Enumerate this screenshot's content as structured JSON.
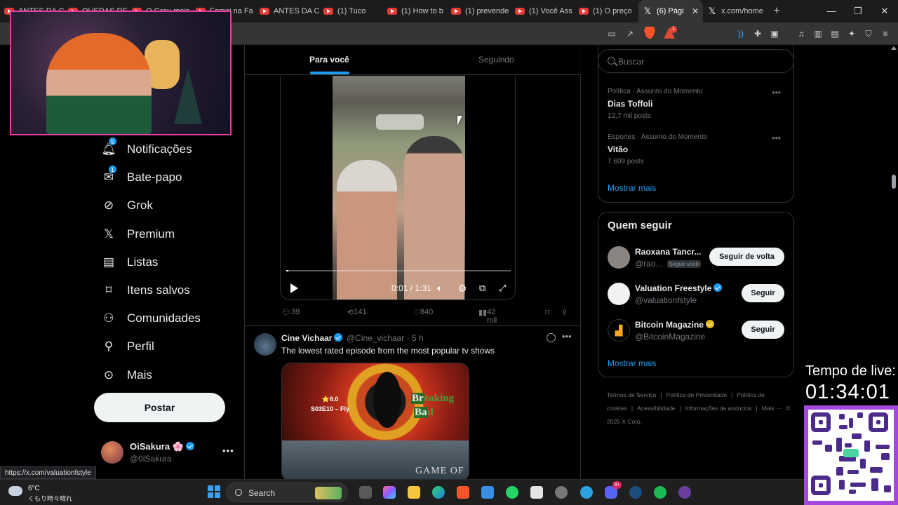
{
  "browser": {
    "tabs": [
      {
        "title": "ANTES DA C",
        "kind": "youtube",
        "active": false
      },
      {
        "title": "QUEDAS DE",
        "kind": "youtube",
        "active": false
      },
      {
        "title": "O Grau mais",
        "kind": "youtube",
        "active": false
      },
      {
        "title": "Fomei na Fa",
        "kind": "youtube",
        "active": false
      },
      {
        "title": "ANTES DA C",
        "kind": "youtube",
        "active": false
      },
      {
        "title": "(1) Tuco",
        "kind": "youtube",
        "active": false
      },
      {
        "title": "(1) How to b",
        "kind": "youtube",
        "active": false
      },
      {
        "title": "(1) prevende",
        "kind": "youtube",
        "active": false
      },
      {
        "title": "(1) Você Ass",
        "kind": "youtube",
        "active": false
      },
      {
        "title": "(1) O preço",
        "kind": "youtube",
        "active": false
      },
      {
        "title": "(6) Pági",
        "kind": "x",
        "active": true
      },
      {
        "title": "x.com/home",
        "kind": "x",
        "active": false
      }
    ],
    "new_tab": "+",
    "rewards_badge": "1",
    "status_url": "https://x.com/valuationfstyle"
  },
  "nav": {
    "items": [
      {
        "label": "Notificações",
        "icon": "bell-icon",
        "badge": "5"
      },
      {
        "label": "Bate-papo",
        "icon": "envelope-icon",
        "badge": "1"
      },
      {
        "label": "Grok",
        "icon": "grok-icon",
        "badge": ""
      },
      {
        "label": "Premium",
        "icon": "x-logo-icon",
        "badge": ""
      },
      {
        "label": "Listas",
        "icon": "list-icon",
        "badge": ""
      },
      {
        "label": "Itens salvos",
        "icon": "bookmark-icon",
        "badge": ""
      },
      {
        "label": "Comunidades",
        "icon": "people-icon",
        "badge": ""
      },
      {
        "label": "Perfil",
        "icon": "person-icon",
        "badge": ""
      },
      {
        "label": "Mais",
        "icon": "more-circle-icon",
        "badge": ""
      }
    ],
    "post_label": "Postar",
    "account": {
      "name": "OiSakura",
      "emoji": "🌸",
      "handle": "@0iSakura",
      "more": "•••"
    }
  },
  "feed": {
    "tabs": [
      {
        "label": "Para você",
        "active": true
      },
      {
        "label": "Seguindo",
        "active": false
      }
    ],
    "video": {
      "time": "0:01 / 1:31",
      "progress": 0.01
    },
    "actions": {
      "replies": "39",
      "reposts": "141",
      "likes": "840",
      "views": "42 mil"
    },
    "tweet": {
      "name": "Cine Vichaar",
      "handle": "@Cine_vichaar · 5 h",
      "text": "The lowest rated episode from the most popular tv shows",
      "media": {
        "score": "⭐8.0",
        "episode": "S03E10 – Fly",
        "show1_a": "Br",
        "show1_b": "eaking",
        "show1_c": "Ba",
        "show1_d": "d",
        "show2": "GAME OF"
      }
    }
  },
  "sidebar": {
    "search_placeholder": "Buscar",
    "trends": [
      {
        "category": "Política · Assunto do Momento",
        "title": "Dias Toffoli",
        "count": "12,7 mil posts"
      },
      {
        "category": "Esportes · Assunto do Momento",
        "title": "Vitão",
        "count": "7.609 posts"
      }
    ],
    "trends_more": "Mostrar mais",
    "who_to_follow": {
      "title": "Quem seguir",
      "items": [
        {
          "name": "Raoxana Tancr...",
          "handle": "@rao...",
          "follows_you": "Segue você",
          "button": "Seguir de volta",
          "verified": "",
          "color": "#8a8580"
        },
        {
          "name": "Valuation Freestyle",
          "handle": "@valuationfstyle",
          "follows_you": "",
          "button": "Seguir",
          "verified": "blue",
          "color": "#f2f2f2"
        },
        {
          "name": "Bitcoin Magazine",
          "handle": "@BitcoinMagazine",
          "follows_you": "",
          "button": "Seguir",
          "verified": "gold",
          "color": "#000000"
        }
      ],
      "more": "Mostrar mais"
    },
    "footer": [
      "Termos de Serviço",
      "|",
      "Política de Privacidade",
      "|",
      "Política de cookies",
      "|",
      "Acessibilidade",
      "|",
      "Informações de anúncios",
      "|",
      "Mais ···",
      "© 2025 X Corp."
    ]
  },
  "overlay": {
    "live_label": "Tempo de live:",
    "live_time": "01:34:01"
  },
  "taskbar": {
    "temp": "6°C",
    "weather": "くもり時々晴れ",
    "search_label": "Search",
    "notification_badge": "9+"
  },
  "colors": {
    "accent": "#1d9bf0",
    "stream_border": "#e83ea5",
    "qr_frame": "#a349e0"
  }
}
